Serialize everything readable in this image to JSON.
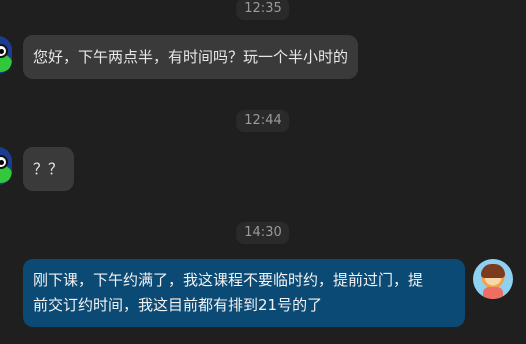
{
  "chat": {
    "timestamps": [
      "12:35",
      "12:44",
      "14:30"
    ],
    "messages": [
      {
        "direction": "incoming",
        "text": "您好，下午两点半，有时间吗？玩一个半小时的"
      },
      {
        "direction": "incoming",
        "text": "？？"
      },
      {
        "direction": "outgoing",
        "text_line1": "刚下课，下午约满了，我这课程不要临时约，提前过门，提",
        "text_line2": "前交订约时间，我这目前都有排到21号的了"
      }
    ]
  },
  "colors": {
    "background": "#1f1f1f",
    "incoming_bubble": "#3a3a3a",
    "outgoing_bubble": "#0b4a74",
    "time_chip": "#2a2a2a"
  },
  "icons": {
    "incoming_avatar": "frog-avatar-icon",
    "outgoing_avatar": "cartoon-girl-avatar-icon"
  }
}
